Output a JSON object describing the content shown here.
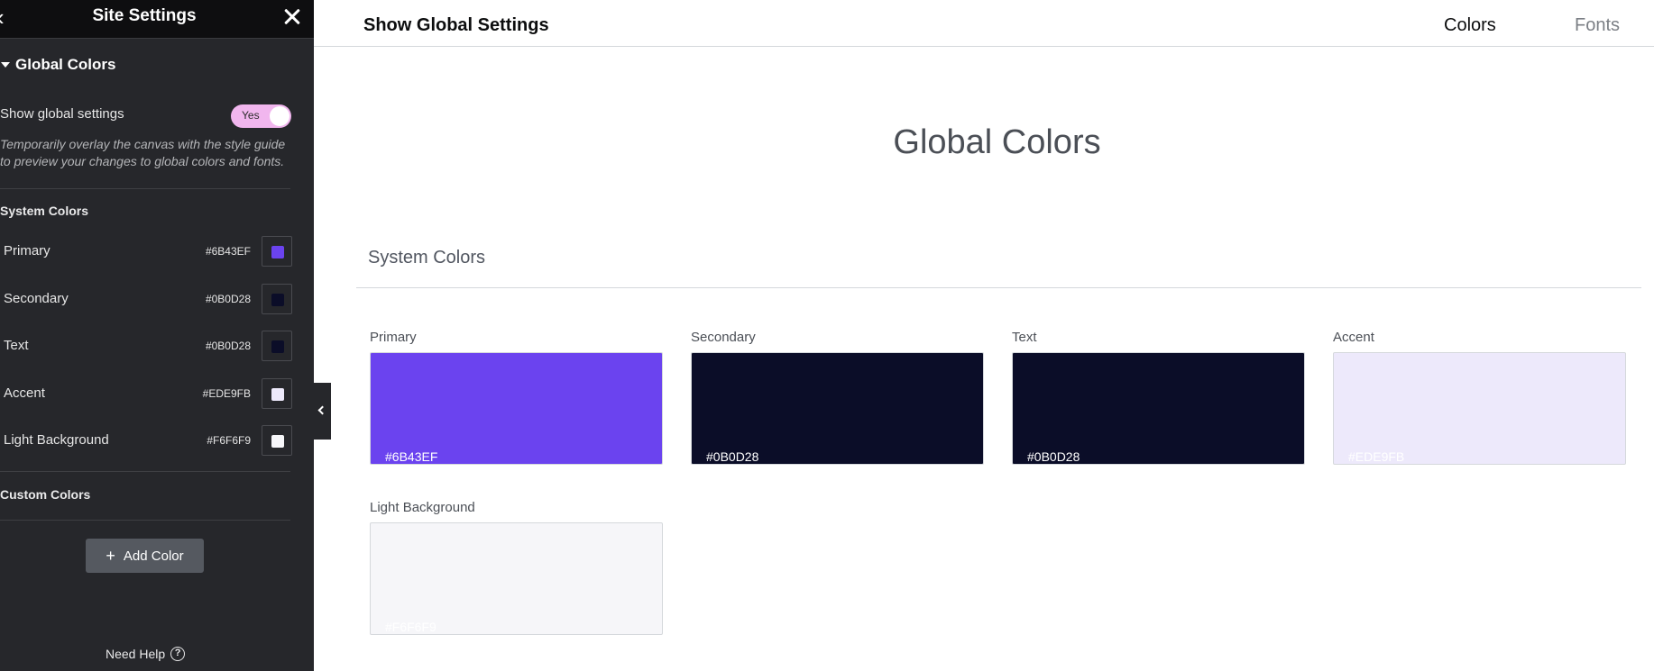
{
  "sidebar": {
    "title": "Site Settings",
    "section_title": "Global Colors",
    "show_global_label": "Show global settings",
    "toggle_value": "Yes",
    "help_text": "Temporarily overlay the canvas with the style guide to preview your changes to global colors and fonts.",
    "system_colors_title": "System Colors",
    "colors": [
      {
        "name": "Primary",
        "hex": "#6B43EF",
        "color": "#6B43EF"
      },
      {
        "name": "Secondary",
        "hex": "#0B0D28",
        "color": "#0B0D28"
      },
      {
        "name": "Text",
        "hex": "#0B0D28",
        "color": "#0B0D28"
      },
      {
        "name": "Accent",
        "hex": "#EDE9FB",
        "color": "#EDE9FB"
      },
      {
        "name": "Light Background",
        "hex": "#F6F6F9",
        "color": "#F6F6F9"
      }
    ],
    "custom_colors_title": "Custom Colors",
    "add_color_label": "Add Color",
    "need_help_label": "Need Help"
  },
  "topbar": {
    "title": "Show Global Settings",
    "tabs": [
      {
        "label": "Colors",
        "active": true
      },
      {
        "label": "Fonts",
        "active": false
      }
    ]
  },
  "main": {
    "heading": "Global Colors",
    "system_colors_heading": "System Colors",
    "cards": [
      {
        "name": "Primary",
        "hex": "#6B43EF",
        "color": "#6B43EF",
        "text_color": "#ffffff"
      },
      {
        "name": "Secondary",
        "hex": "#0B0D28",
        "color": "#0B0D28",
        "text_color": "#ffffff"
      },
      {
        "name": "Text",
        "hex": "#0B0D28",
        "color": "#0B0D28",
        "text_color": "#ffffff"
      },
      {
        "name": "Accent",
        "hex": "#EDE9FB",
        "color": "#EDE9FB",
        "text_color": "#ffffff"
      },
      {
        "name": "Light Background",
        "hex": "#F6F6F9",
        "color": "#F6F6F9",
        "text_color": "#ffffff"
      }
    ]
  }
}
